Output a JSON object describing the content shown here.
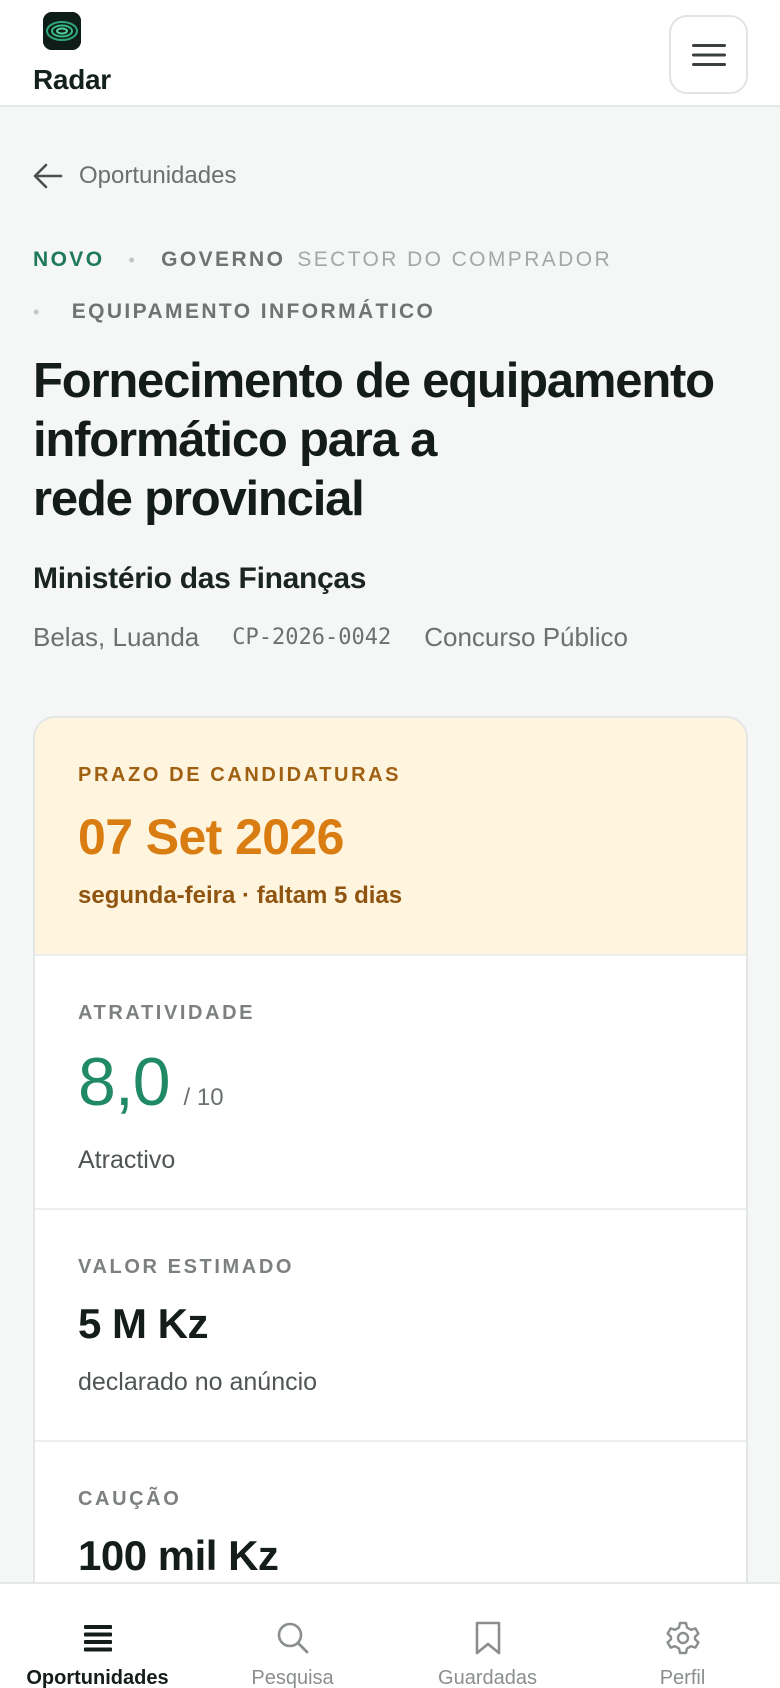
{
  "app": {
    "title": "Radar",
    "logo_icon": "radar-logo-icon",
    "menu_icon": "hamburger-menu-icon"
  },
  "back": {
    "label": "Oportunidades",
    "icon": "arrow-left-icon"
  },
  "tags": {
    "status": "NOVO",
    "buyer_sector_value": "GOVERNO",
    "buyer_sector_label": "SECTOR DO COMPRADOR",
    "category": "EQUIPAMENTO INFORMÁTICO"
  },
  "tender": {
    "title_line1": "Fornecimento de equipamento",
    "title_line2": "informático para a",
    "title_line3": "rede provincial",
    "buyer": "Ministério das Finanças",
    "location": "Belas, Luanda",
    "reference": "CP-2026-0042",
    "procedure": "Concurso Público"
  },
  "deadline": {
    "label": "PRAZO DE CANDIDATURAS",
    "date": "07 Set 2026",
    "sub": "segunda-feira · faltam 5 dias"
  },
  "attractiveness": {
    "label": "ATRATIVIDADE",
    "score": "8,0",
    "max": "/ 10",
    "description": "Atractivo"
  },
  "estimated_value": {
    "label": "VALOR ESTIMADO",
    "amount": "5 M Kz",
    "description": "declarado no anúncio"
  },
  "bond": {
    "label": "CAUÇÃO",
    "amount": "100 mil Kz"
  },
  "nav": {
    "items": [
      {
        "label": "Oportunidades",
        "icon": "list-stack-icon",
        "active": true
      },
      {
        "label": "Pesquisa",
        "icon": "search-icon",
        "active": false
      },
      {
        "label": "Guardadas",
        "icon": "bookmark-icon",
        "active": false
      },
      {
        "label": "Perfil",
        "icon": "gear-icon",
        "active": false
      }
    ]
  },
  "colors": {
    "accent_green": "#1f8a63",
    "deadline_bg": "#fff4dd",
    "deadline_orange": "#d97c11",
    "text_dark": "#131c19"
  }
}
